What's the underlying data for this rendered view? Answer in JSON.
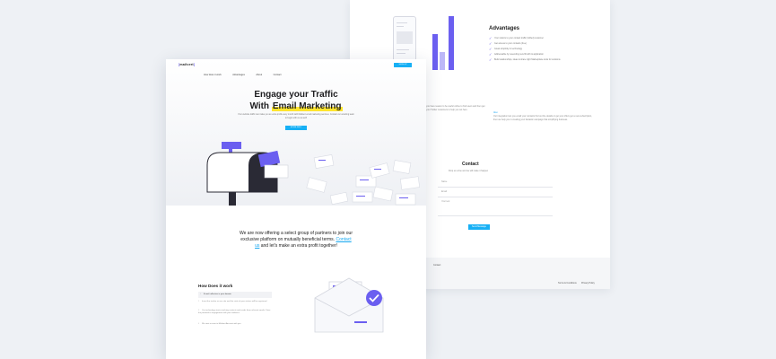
{
  "back_page": {
    "advantages": {
      "title": "Advantages",
      "items": [
        "Your visitors to your contact traffic (Gifted) customer",
        "Get access to your contacts (free)",
        "Great simplicity in technology",
        "Addressable by resending new fill with & application",
        "Build relationships, ideas & share right Marketplace tools for solutions"
      ]
    },
    "section_left_text": "you have reason to be useful online to find users and then get your Twitter customers to help you out here",
    "section_right_label": "Also",
    "section_right_text": "Our integration lets you email your contacts find out the details or get your offers get a new subscription, then we help you in creating your fantastic campaign that simplifying business.",
    "contact": {
      "title": "Contact",
      "subtitle": "Drop us a line and we will make it happen",
      "name_placeholder": "Name",
      "email_placeholder": "Email",
      "message_placeholder": "Your text",
      "send_label": "Send Message"
    },
    "footer": {
      "contact_label": "Contact",
      "terms_label": "Terms & Conditions",
      "privacy_label": "Privacy Policy"
    }
  },
  "front_page": {
    "logo": "mailvert",
    "nav": {
      "items": [
        "How does it work",
        "Advantages",
        "About",
        "Contact"
      ],
      "signup_label": "SIGN UP"
    },
    "hero": {
      "title_line1": "Engage your Traffic",
      "title_line2_prefix": "With ",
      "title_highlight": "Email Marketing",
      "subtitle": "Your website traffic can make you an extra profit every month with Mailvert email marketing services. Contact our amazing team to begin with us as well!",
      "cta_label": "MORE INFO"
    },
    "offer": {
      "text_before": "We are now offering a select group of partners to join our exclusive platform on mutually beneficial terms.",
      "link": "Contact us",
      "text_after": " and let's make an extra profit together!"
    },
    "how_it_works": {
      "title": "How Does it work",
      "steps": [
        {
          "num": "1",
          "text": "E-mail collection in your domain"
        },
        {
          "num": "2",
          "text": "Insert the tracker on our site and the visits of your visitors will be registered"
        },
        {
          "num": "3",
          "text": "Our technology starts reaching contacts and sends them relevant emails. Drive the potential to engagement with your audience"
        },
        {
          "num": "4",
          "text": "We start to save to Mailvert Account with you"
        }
      ]
    },
    "colors": {
      "accent": "#6b5ff0",
      "cta": "#17b0f5",
      "highlight": "#ffe52e"
    }
  }
}
